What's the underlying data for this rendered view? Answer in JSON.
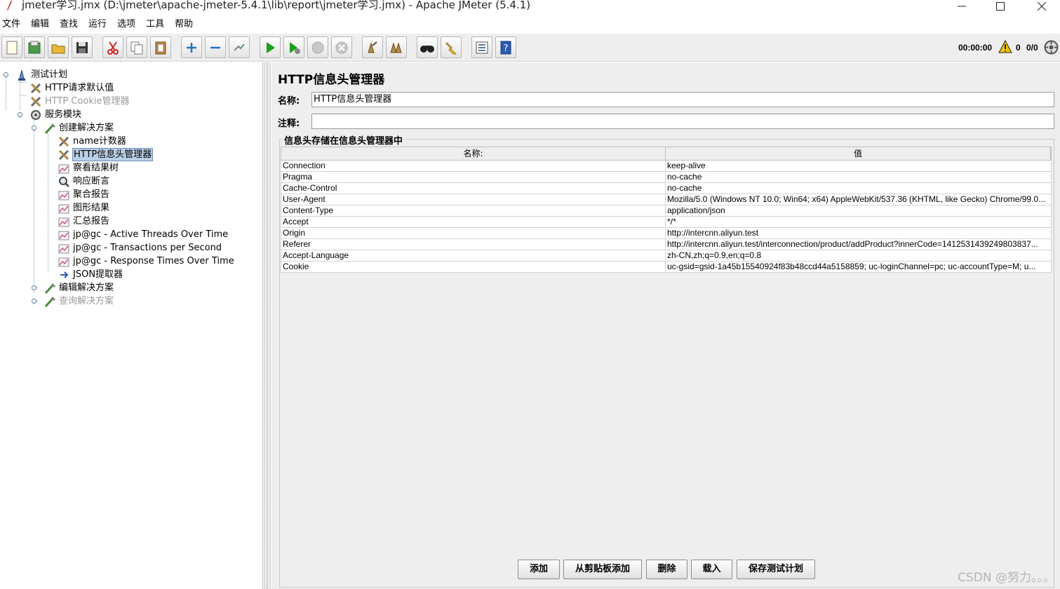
{
  "window": {
    "title": "jmeter学习.jmx (D:\\jmeter\\apache-jmeter-5.4.1\\lib\\report\\jmeter学习.jmx) - Apache JMeter (5.4.1)"
  },
  "menu": [
    "文件",
    "编辑",
    "查找",
    "运行",
    "选项",
    "工具",
    "帮助"
  ],
  "toolbar": {
    "timer": "00:00:00",
    "warning_count": "0",
    "threads": "0/0",
    "buttons": [
      "new-icon",
      "templates-icon",
      "open-icon",
      "save-icon",
      "cut-icon",
      "copy-icon",
      "paste-icon",
      "expand-icon",
      "collapse-icon",
      "toggle-icon",
      "start-icon",
      "start-no-pause-icon",
      "stop-icon",
      "shutdown-icon",
      "clear-icon",
      "clear-all-icon",
      "search-icon",
      "reset-search-icon",
      "function-helper-icon",
      "help-icon"
    ]
  },
  "tree": [
    {
      "label": "测试计划",
      "icon": "test-plan-icon"
    },
    {
      "label": "HTTP请求默认值",
      "icon": "config-icon"
    },
    {
      "label": "HTTP Cookie管理器",
      "icon": "config-icon",
      "disabled": true
    },
    {
      "label": "服务模块",
      "icon": "thread-group-icon"
    },
    {
      "label": "创建解决方案",
      "icon": "controller-icon"
    },
    {
      "label": "name计数器",
      "icon": "config-icon"
    },
    {
      "label": "HTTP信息头管理器",
      "icon": "config-icon",
      "selected": true
    },
    {
      "label": "察看结果树",
      "icon": "listener-icon"
    },
    {
      "label": "响应断言",
      "icon": "assertion-icon"
    },
    {
      "label": "聚合报告",
      "icon": "listener-icon"
    },
    {
      "label": "图形结果",
      "icon": "listener-icon"
    },
    {
      "label": "汇总报告",
      "icon": "listener-icon"
    },
    {
      "label": "jp@gc - Active Threads Over Time",
      "icon": "listener-icon"
    },
    {
      "label": "jp@gc - Transactions per Second",
      "icon": "listener-icon"
    },
    {
      "label": "jp@gc - Response Times Over Time",
      "icon": "listener-icon"
    },
    {
      "label": "JSON提取器",
      "icon": "extractor-icon"
    },
    {
      "label": "编辑解决方案",
      "icon": "controller-icon"
    },
    {
      "label": "查询解决方案",
      "icon": "controller-icon",
      "disabled": true
    }
  ],
  "panel": {
    "title": "HTTP信息头管理器",
    "name_label": "名称:",
    "name_value": "HTTP信息头管理器",
    "comment_label": "注释:",
    "comment_value": "",
    "group_title": "信息头存储在信息头管理器中",
    "columns": [
      "名称:",
      "值"
    ],
    "headers": [
      [
        "Connection",
        "keep-alive"
      ],
      [
        "Pragma",
        "no-cache"
      ],
      [
        "Cache-Control",
        "no-cache"
      ],
      [
        "User-Agent",
        "Mozilla/5.0 (Windows NT 10.0; Win64; x64) AppleWebKit/537.36 (KHTML, like Gecko) Chrome/99.0..."
      ],
      [
        "Content-Type",
        "application/json"
      ],
      [
        "Accept",
        "*/*"
      ],
      [
        "Origin",
        "http://intercnn.aliyun.test"
      ],
      [
        "Referer",
        "http://intercnn.aliyun.test/interconnection/product/addProduct?innerCode=1412531439249803837..."
      ],
      [
        "Accept-Language",
        "zh-CN,zh;q=0.9,en;q=0.8"
      ],
      [
        "Cookie",
        "uc-gsid=gsid-1a45b15540924f83b48ccd44a5158859; uc-loginChannel=pc; uc-accountType=M; u..."
      ]
    ],
    "buttons": {
      "add": "添加",
      "add_clipboard": "从剪贴板添加",
      "delete": "删除",
      "load": "载入",
      "save_plan": "保存测试计划"
    }
  },
  "watermark": "CSDN @努力。。。"
}
